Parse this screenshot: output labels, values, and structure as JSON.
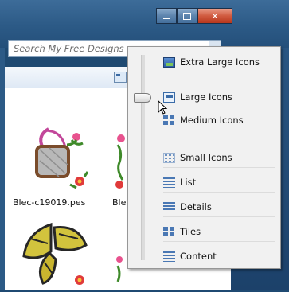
{
  "window": {
    "search_placeholder": "Search My Free Designs"
  },
  "files": [
    {
      "name": "Blec-c19019.pes"
    },
    {
      "name": "Ble"
    }
  ],
  "view_menu": {
    "items": [
      {
        "label": "Extra Large Icons",
        "icon": "extra-large-icons-icon"
      },
      {
        "label": "Large Icons",
        "icon": "large-icons-icon"
      },
      {
        "label": "Medium Icons",
        "icon": "medium-icons-icon"
      },
      {
        "label": "Small Icons",
        "icon": "small-icons-icon"
      },
      {
        "label": "List",
        "icon": "list-icon"
      },
      {
        "label": "Details",
        "icon": "details-icon"
      },
      {
        "label": "Tiles",
        "icon": "tiles-icon"
      },
      {
        "label": "Content",
        "icon": "content-icon"
      }
    ],
    "selected": "Large Icons"
  },
  "colors": {
    "title_bar": "#2c5a86",
    "menu_bg": "#f1f1f1",
    "close_button": "#c9482b"
  }
}
